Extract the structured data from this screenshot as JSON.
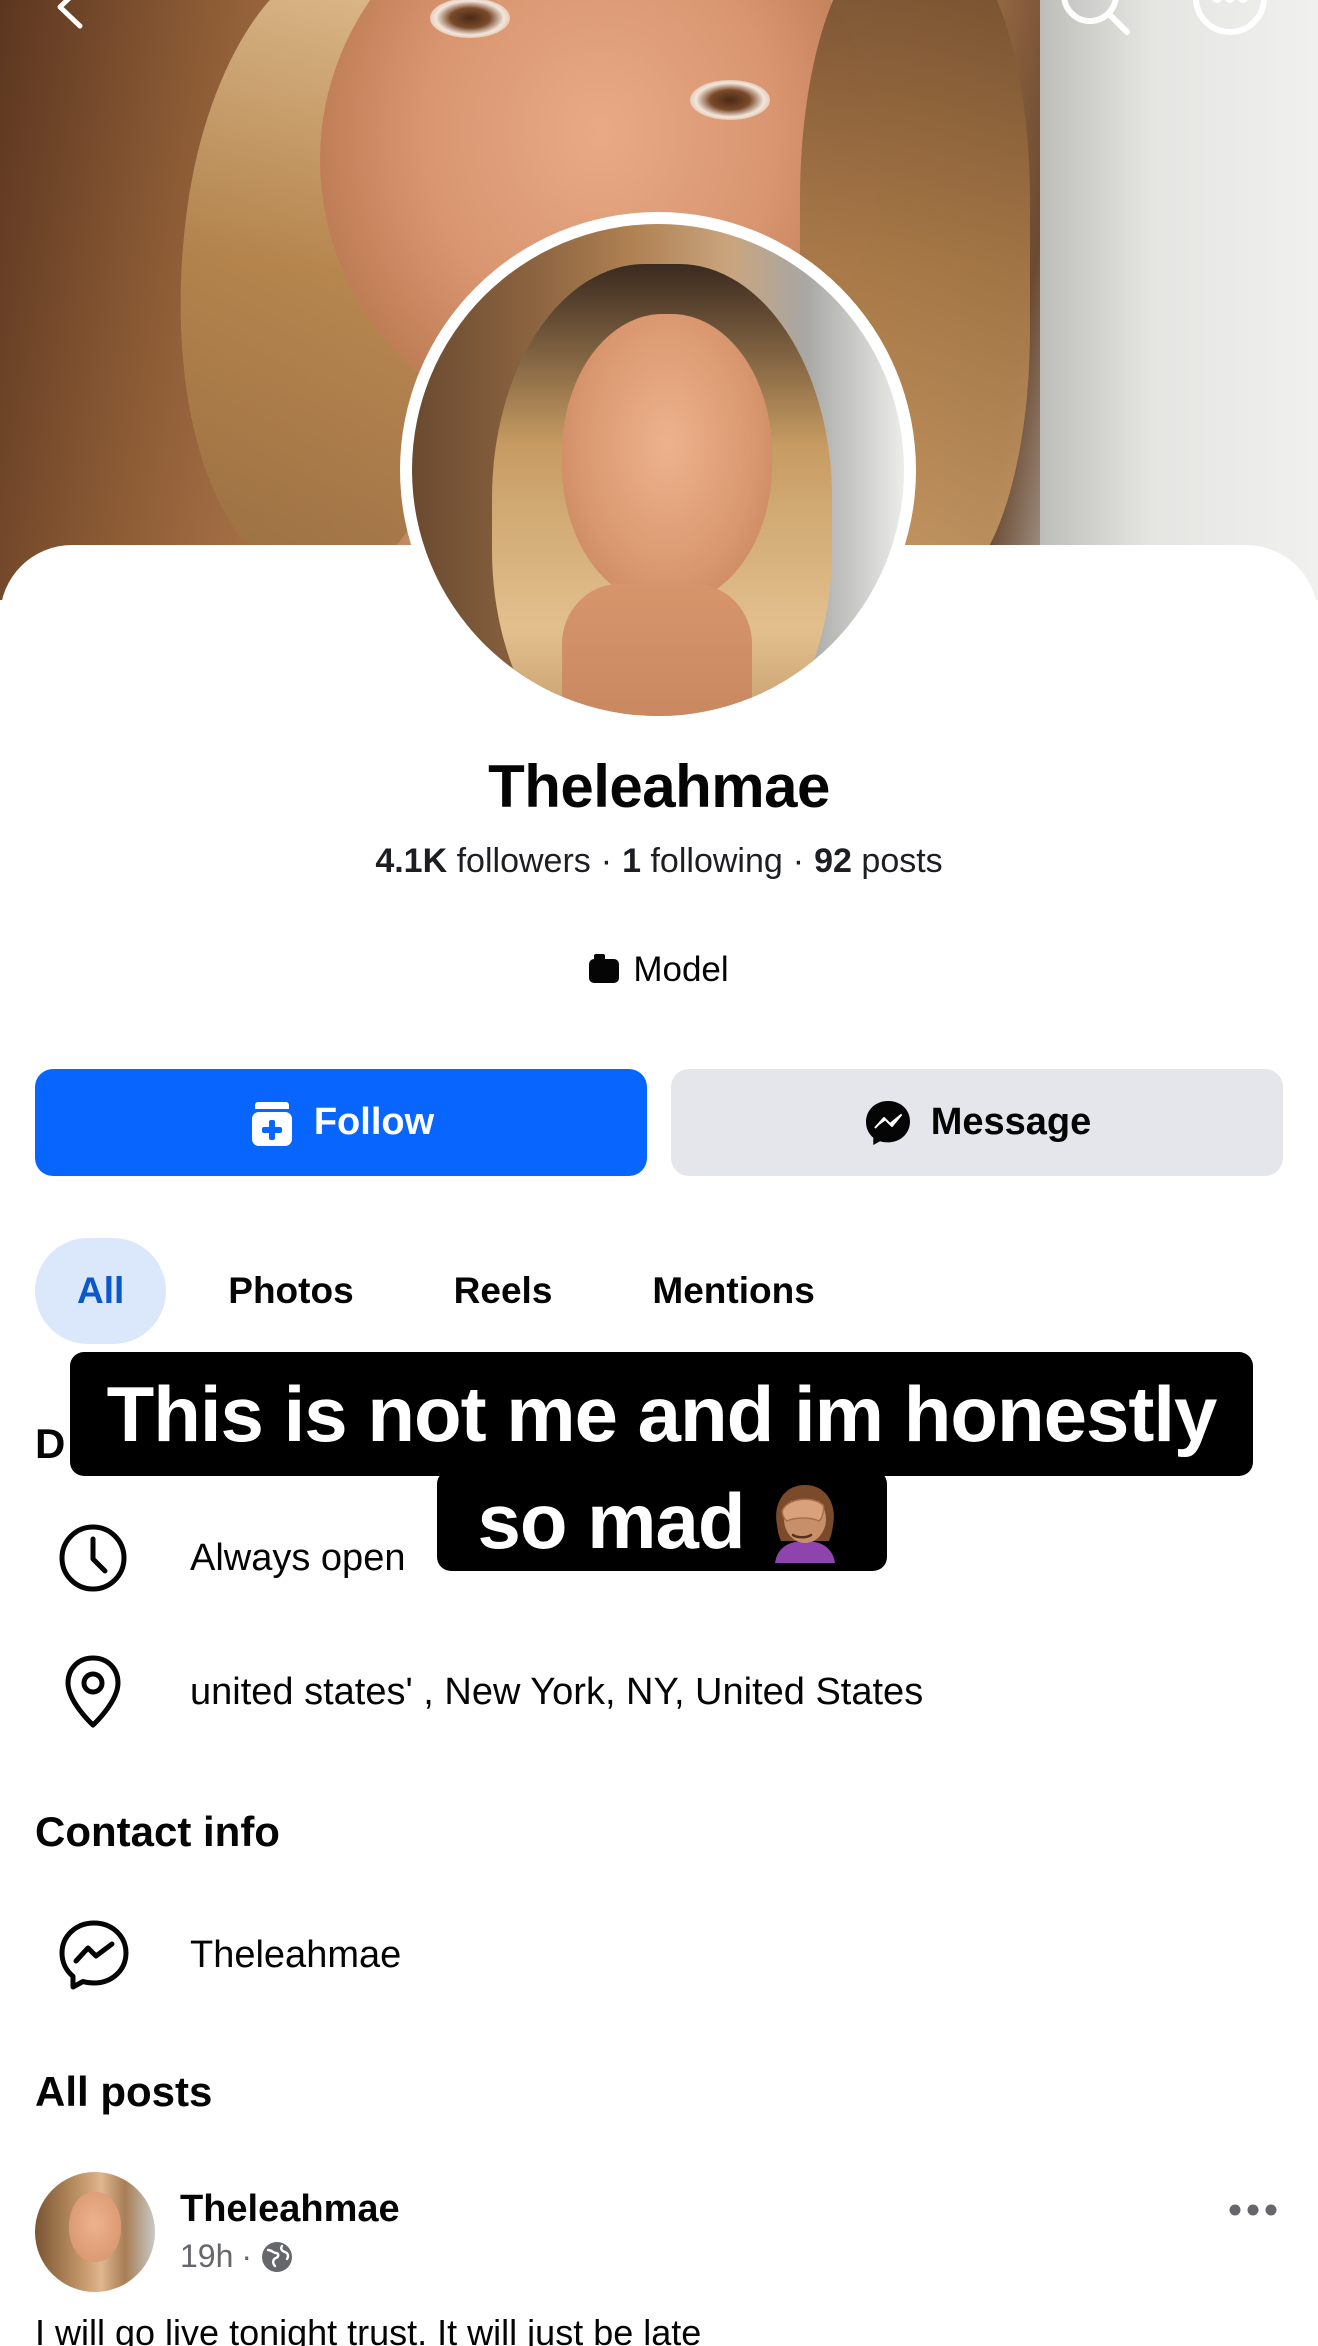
{
  "cover": {
    "icons": [
      "back-arrow-icon",
      "search-icon",
      "more-options-icon"
    ]
  },
  "profile": {
    "name": "Theleahmae",
    "followers_count": "4.1K",
    "followers_label": "followers",
    "following_count": "1",
    "following_label": "following",
    "posts_count": "92",
    "posts_label": "posts",
    "separator": "·",
    "category": "Model"
  },
  "actions": {
    "follow_label": "Follow",
    "message_label": "Message"
  },
  "tabs": [
    {
      "label": "All",
      "active": true
    },
    {
      "label": "Photos",
      "active": false
    },
    {
      "label": "Reels",
      "active": false
    },
    {
      "label": "Mentions",
      "active": false
    }
  ],
  "details": {
    "heading_visible": "D",
    "hours": "Always open",
    "location": "united states' , New York, NY, United States"
  },
  "contact": {
    "heading": "Contact info",
    "messenger": "Theleahmae"
  },
  "posts": {
    "heading": "All posts",
    "first": {
      "author": "Theleahmae",
      "time": "19h",
      "separator": "·",
      "text": "I will go live tonight trust. It will just be late"
    }
  },
  "overlay_caption": {
    "line1": "This is not me and im honestly",
    "line2": "so mad",
    "emoji": "facepalm-icon"
  },
  "colors": {
    "primary": "#0866ff",
    "secondary_button": "#e4e6eb",
    "active_tab_bg": "#dbe8fb",
    "active_tab_text": "#0a58ca",
    "meta_text": "#65676b"
  }
}
